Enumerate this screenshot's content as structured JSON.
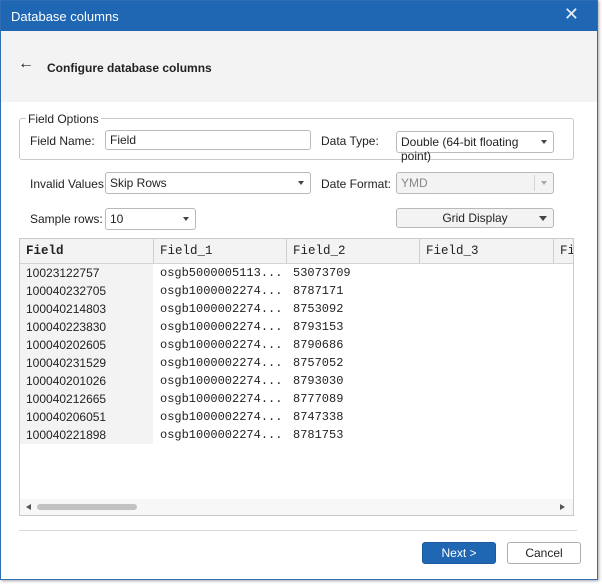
{
  "window": {
    "title": "Database columns"
  },
  "header": {
    "title": "Configure database columns"
  },
  "field_options": {
    "legend": "Field Options",
    "field_name_label": "Field Name:",
    "field_name_value": "Field",
    "data_type_label": "Data Type:",
    "data_type_value": "Double (64-bit floating point)"
  },
  "invalid_values": {
    "label": "Invalid Values:",
    "value": "Skip Rows"
  },
  "date_format": {
    "label": "Date Format:",
    "value": "YMD"
  },
  "sample_rows": {
    "label": "Sample rows:",
    "value": "10"
  },
  "grid_display": {
    "label": "Grid Display"
  },
  "grid": {
    "headers": [
      "Field",
      "Field_1",
      "Field_2",
      "Field_3",
      "Fi"
    ],
    "col0": [
      "10023122757",
      "100040232705",
      "100040214803",
      "100040223830",
      "100040202605",
      "100040231529",
      "100040201026",
      "100040212665",
      "100040206051",
      "100040221898"
    ],
    "col1": [
      "osgb5000005113...",
      "osgb1000002274...",
      "osgb1000002274...",
      "osgb1000002274...",
      "osgb1000002274...",
      "osgb1000002274...",
      "osgb1000002274...",
      "osgb1000002274...",
      "osgb1000002274...",
      "osgb1000002274..."
    ],
    "col2": [
      "53073709",
      "8787171",
      "8753092",
      "8793153",
      "8790686",
      "8757052",
      "8793030",
      "8777089",
      "8747338",
      "8781753"
    ]
  },
  "buttons": {
    "next": "Next >",
    "cancel": "Cancel"
  },
  "colors": {
    "accent": "#1f66b3"
  }
}
